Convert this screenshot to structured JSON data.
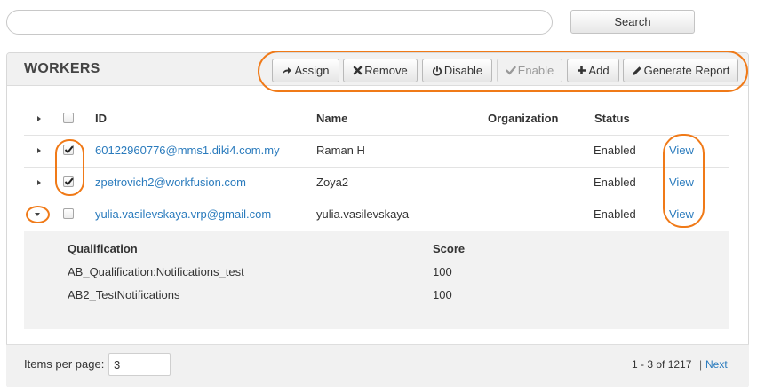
{
  "search": {
    "value": "",
    "placeholder": "",
    "button_label": "Search"
  },
  "panel": {
    "title": "WORKERS"
  },
  "toolbar": {
    "assign_label": "Assign",
    "remove_label": "Remove",
    "disable_label": "Disable",
    "enable_label": "Enable",
    "add_label": "Add",
    "report_label": "Generate Report"
  },
  "table": {
    "headers": {
      "id": "ID",
      "name": "Name",
      "organization": "Organization",
      "status": "Status"
    },
    "rows": [
      {
        "id": "60122960776@mms1.diki4.com.my",
        "name": "Raman H",
        "organization": "",
        "status": "Enabled",
        "action": "View",
        "checked": true,
        "expanded": false
      },
      {
        "id": "zpetrovich2@workfusion.com",
        "name": "Zoya2",
        "organization": "",
        "status": "Enabled",
        "action": "View",
        "checked": true,
        "expanded": false
      },
      {
        "id": "yulia.vasilevskaya.vrp@gmail.com",
        "name": "yulia.vasilevskaya",
        "organization": "",
        "status": "Enabled",
        "action": "View",
        "checked": false,
        "expanded": true
      }
    ]
  },
  "details": {
    "headers": {
      "qualification": "Qualification",
      "score": "Score"
    },
    "rows": [
      {
        "qualification": "AB_Qualification:Notifications_test",
        "score": "100"
      },
      {
        "qualification": "AB2_TestNotifications",
        "score": "100"
      }
    ]
  },
  "footer": {
    "items_per_page_label": "Items per page:",
    "items_per_page_value": "3",
    "range_text": "1 - 3 of 1217",
    "separator": "|",
    "next_label": "Next"
  },
  "colors": {
    "annotation": "#f07a18",
    "link": "#2a7bbd",
    "header_bg": "#f1f1f1"
  },
  "icons": [
    "share-arrow-icon",
    "x-icon",
    "power-icon",
    "checkmark-icon",
    "plus-icon",
    "pencil-icon",
    "caret-right-icon",
    "caret-down-icon"
  ]
}
